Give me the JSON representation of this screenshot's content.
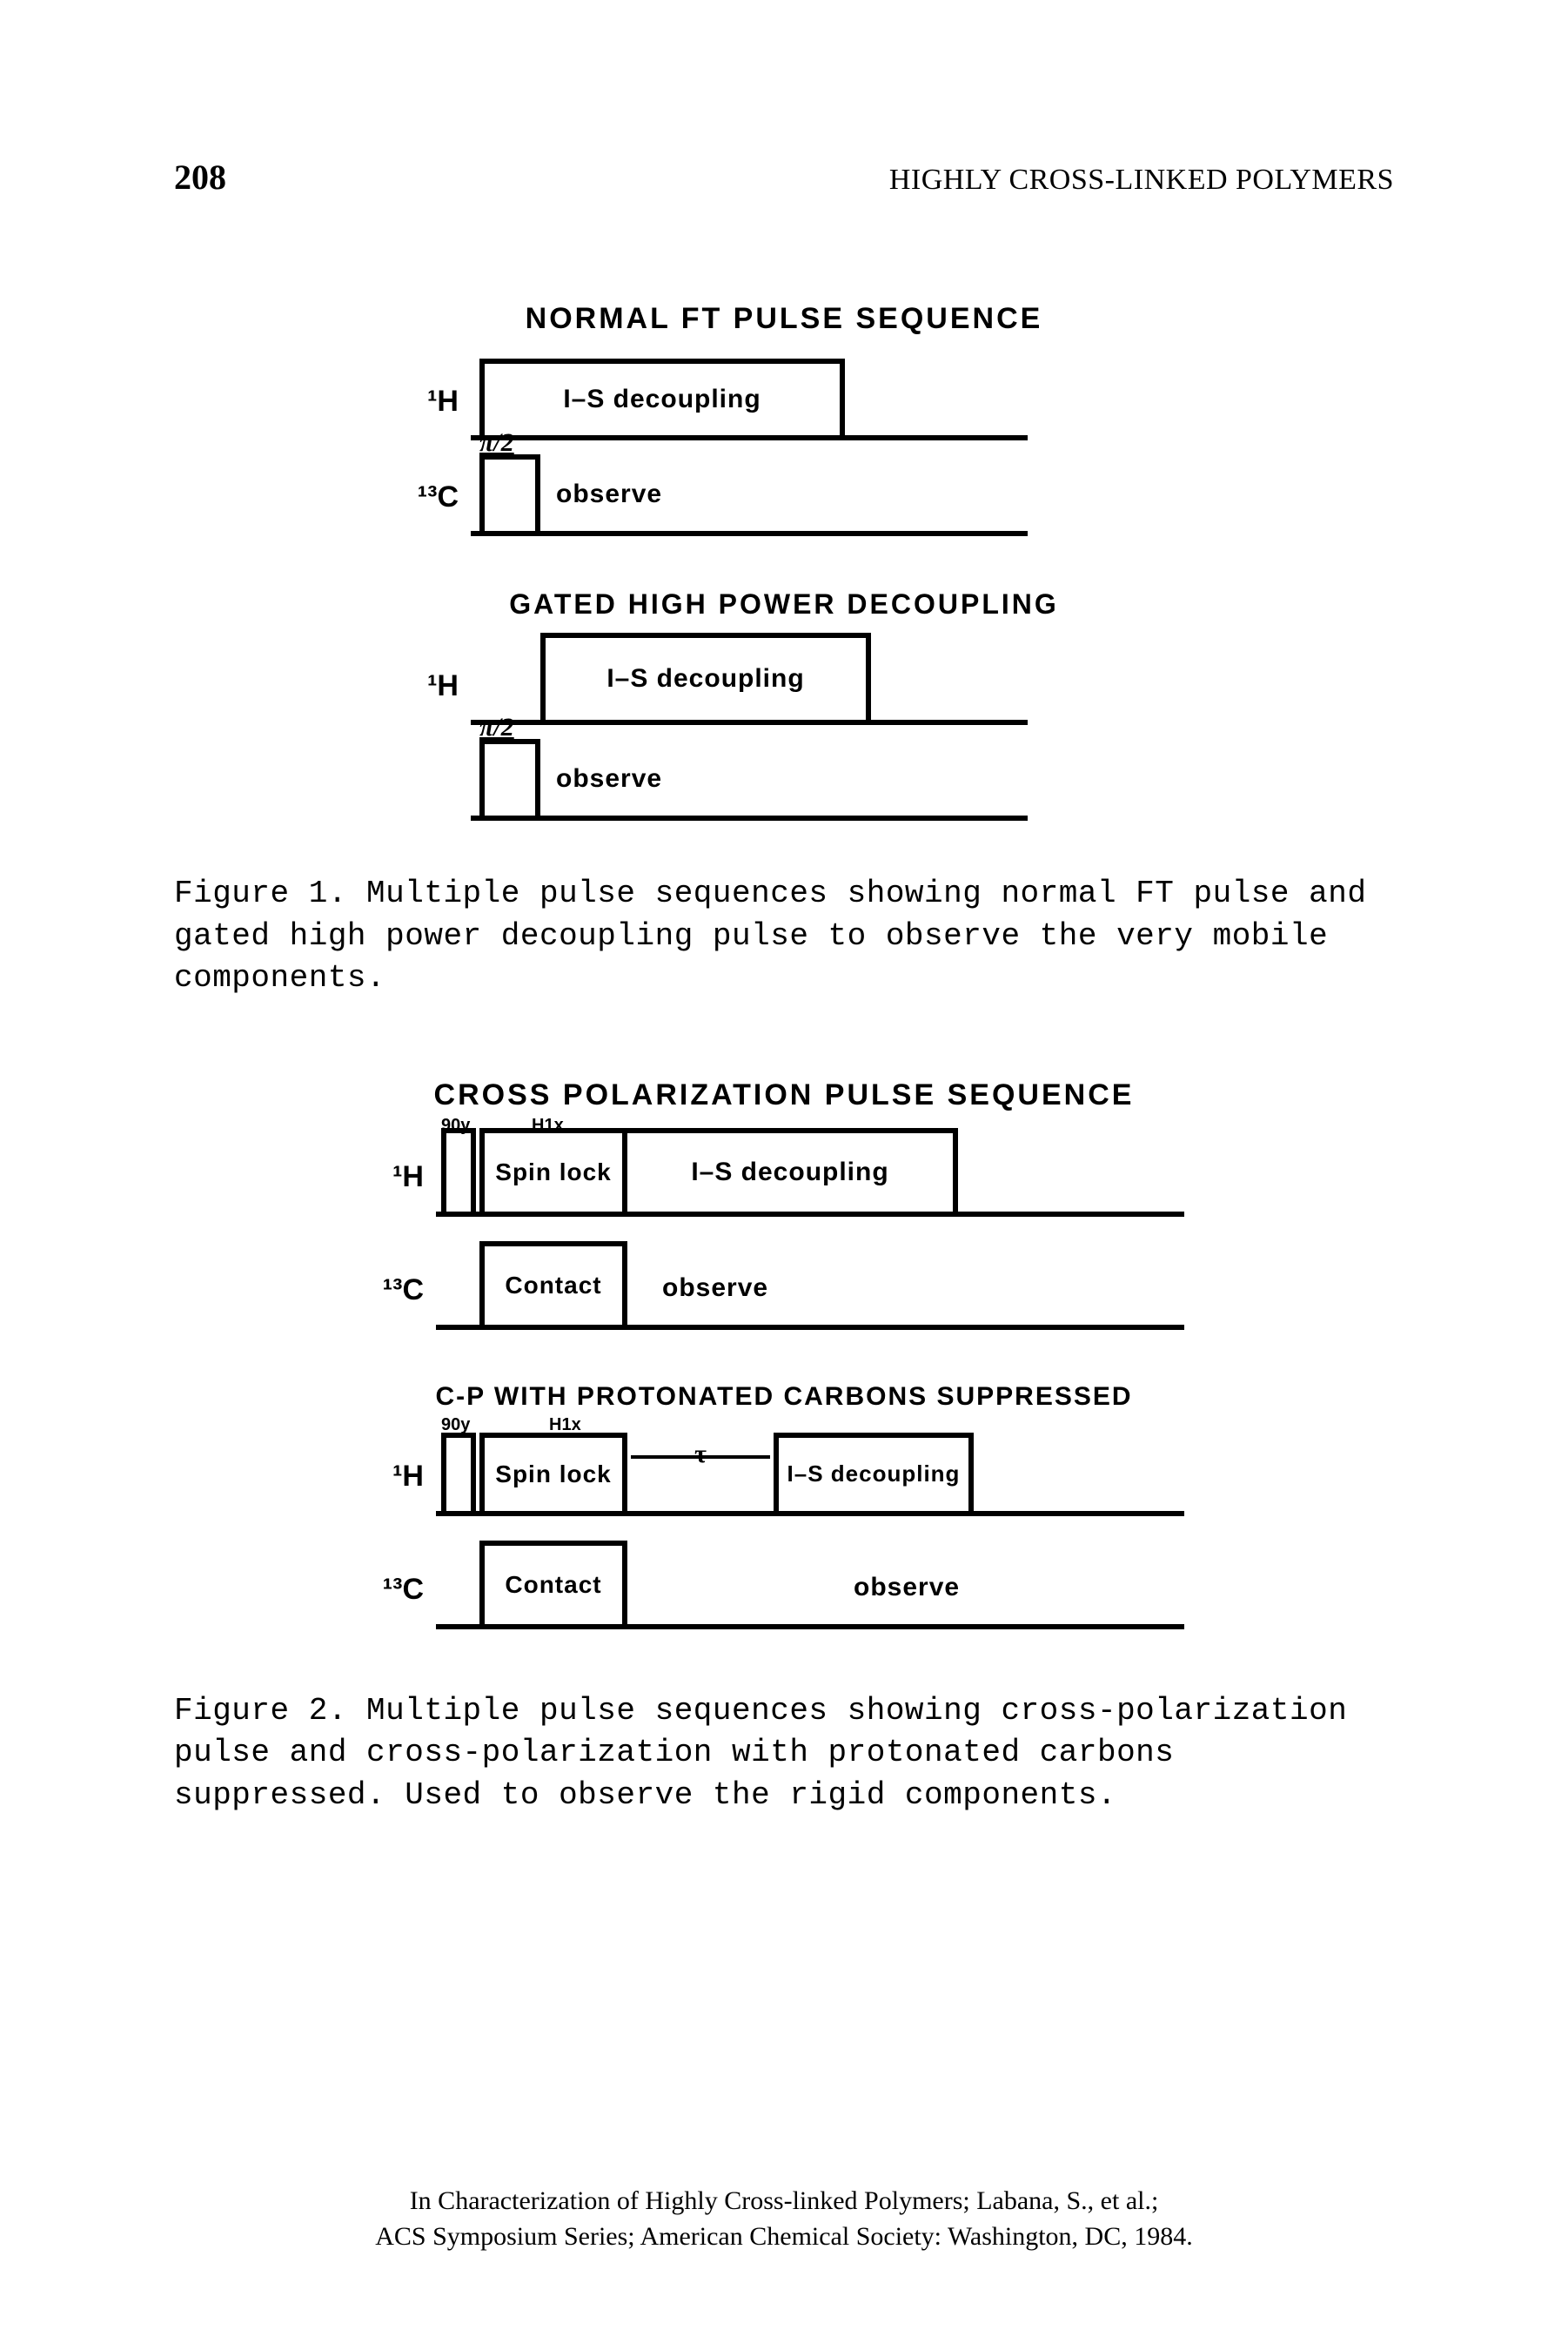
{
  "page": {
    "number": "208",
    "running_head": "HIGHLY CROSS-LINKED POLYMERS"
  },
  "figure1": {
    "title": "NORMAL FT PULSE SEQUENCE",
    "seq_a": {
      "h_label": "¹H",
      "h_box": "I–S decoupling",
      "c_label": "¹³C",
      "c_pulse_annot": "π/2",
      "c_free": "observe"
    },
    "subtitle": "GATED HIGH POWER DECOUPLING",
    "seq_b": {
      "h_label": "¹H",
      "h_box": "I–S decoupling",
      "c_pulse_annot": "π/2",
      "c_free": "observe"
    },
    "caption": "Figure 1. Multiple pulse sequences showing normal FT pulse and gated high power decoupling pulse to observe the very mobile components."
  },
  "figure2": {
    "title": "CROSS POLARIZATION PULSE SEQUENCE",
    "seq_a": {
      "h_label": "¹H",
      "annot90y": "90y",
      "annotH1x": "H1x",
      "h_spin": "Spin lock",
      "h_decouple": "I–S decoupling",
      "c_label": "¹³C",
      "c_contact": "Contact",
      "c_free": "observe"
    },
    "subtitle": "C-P WITH PROTONATED CARBONS SUPPRESSED",
    "seq_b": {
      "h_label": "¹H",
      "annot90y": "90y",
      "annotH1x": "H1x",
      "h_spin": "Spin lock",
      "tau": "τ",
      "h_decouple": "I–S decoupling",
      "c_label": "¹³C",
      "c_contact": "Contact",
      "c_free": "observe"
    },
    "caption": "Figure 2. Multiple pulse sequences showing cross-polarization pulse and cross-polarization with protonated carbons suppressed. Used to observe the rigid components."
  },
  "footer": {
    "line1": "In Characterization of Highly Cross-linked Polymers; Labana, S., et al.;",
    "line2": "ACS Symposium Series; American Chemical Society: Washington, DC, 1984."
  }
}
